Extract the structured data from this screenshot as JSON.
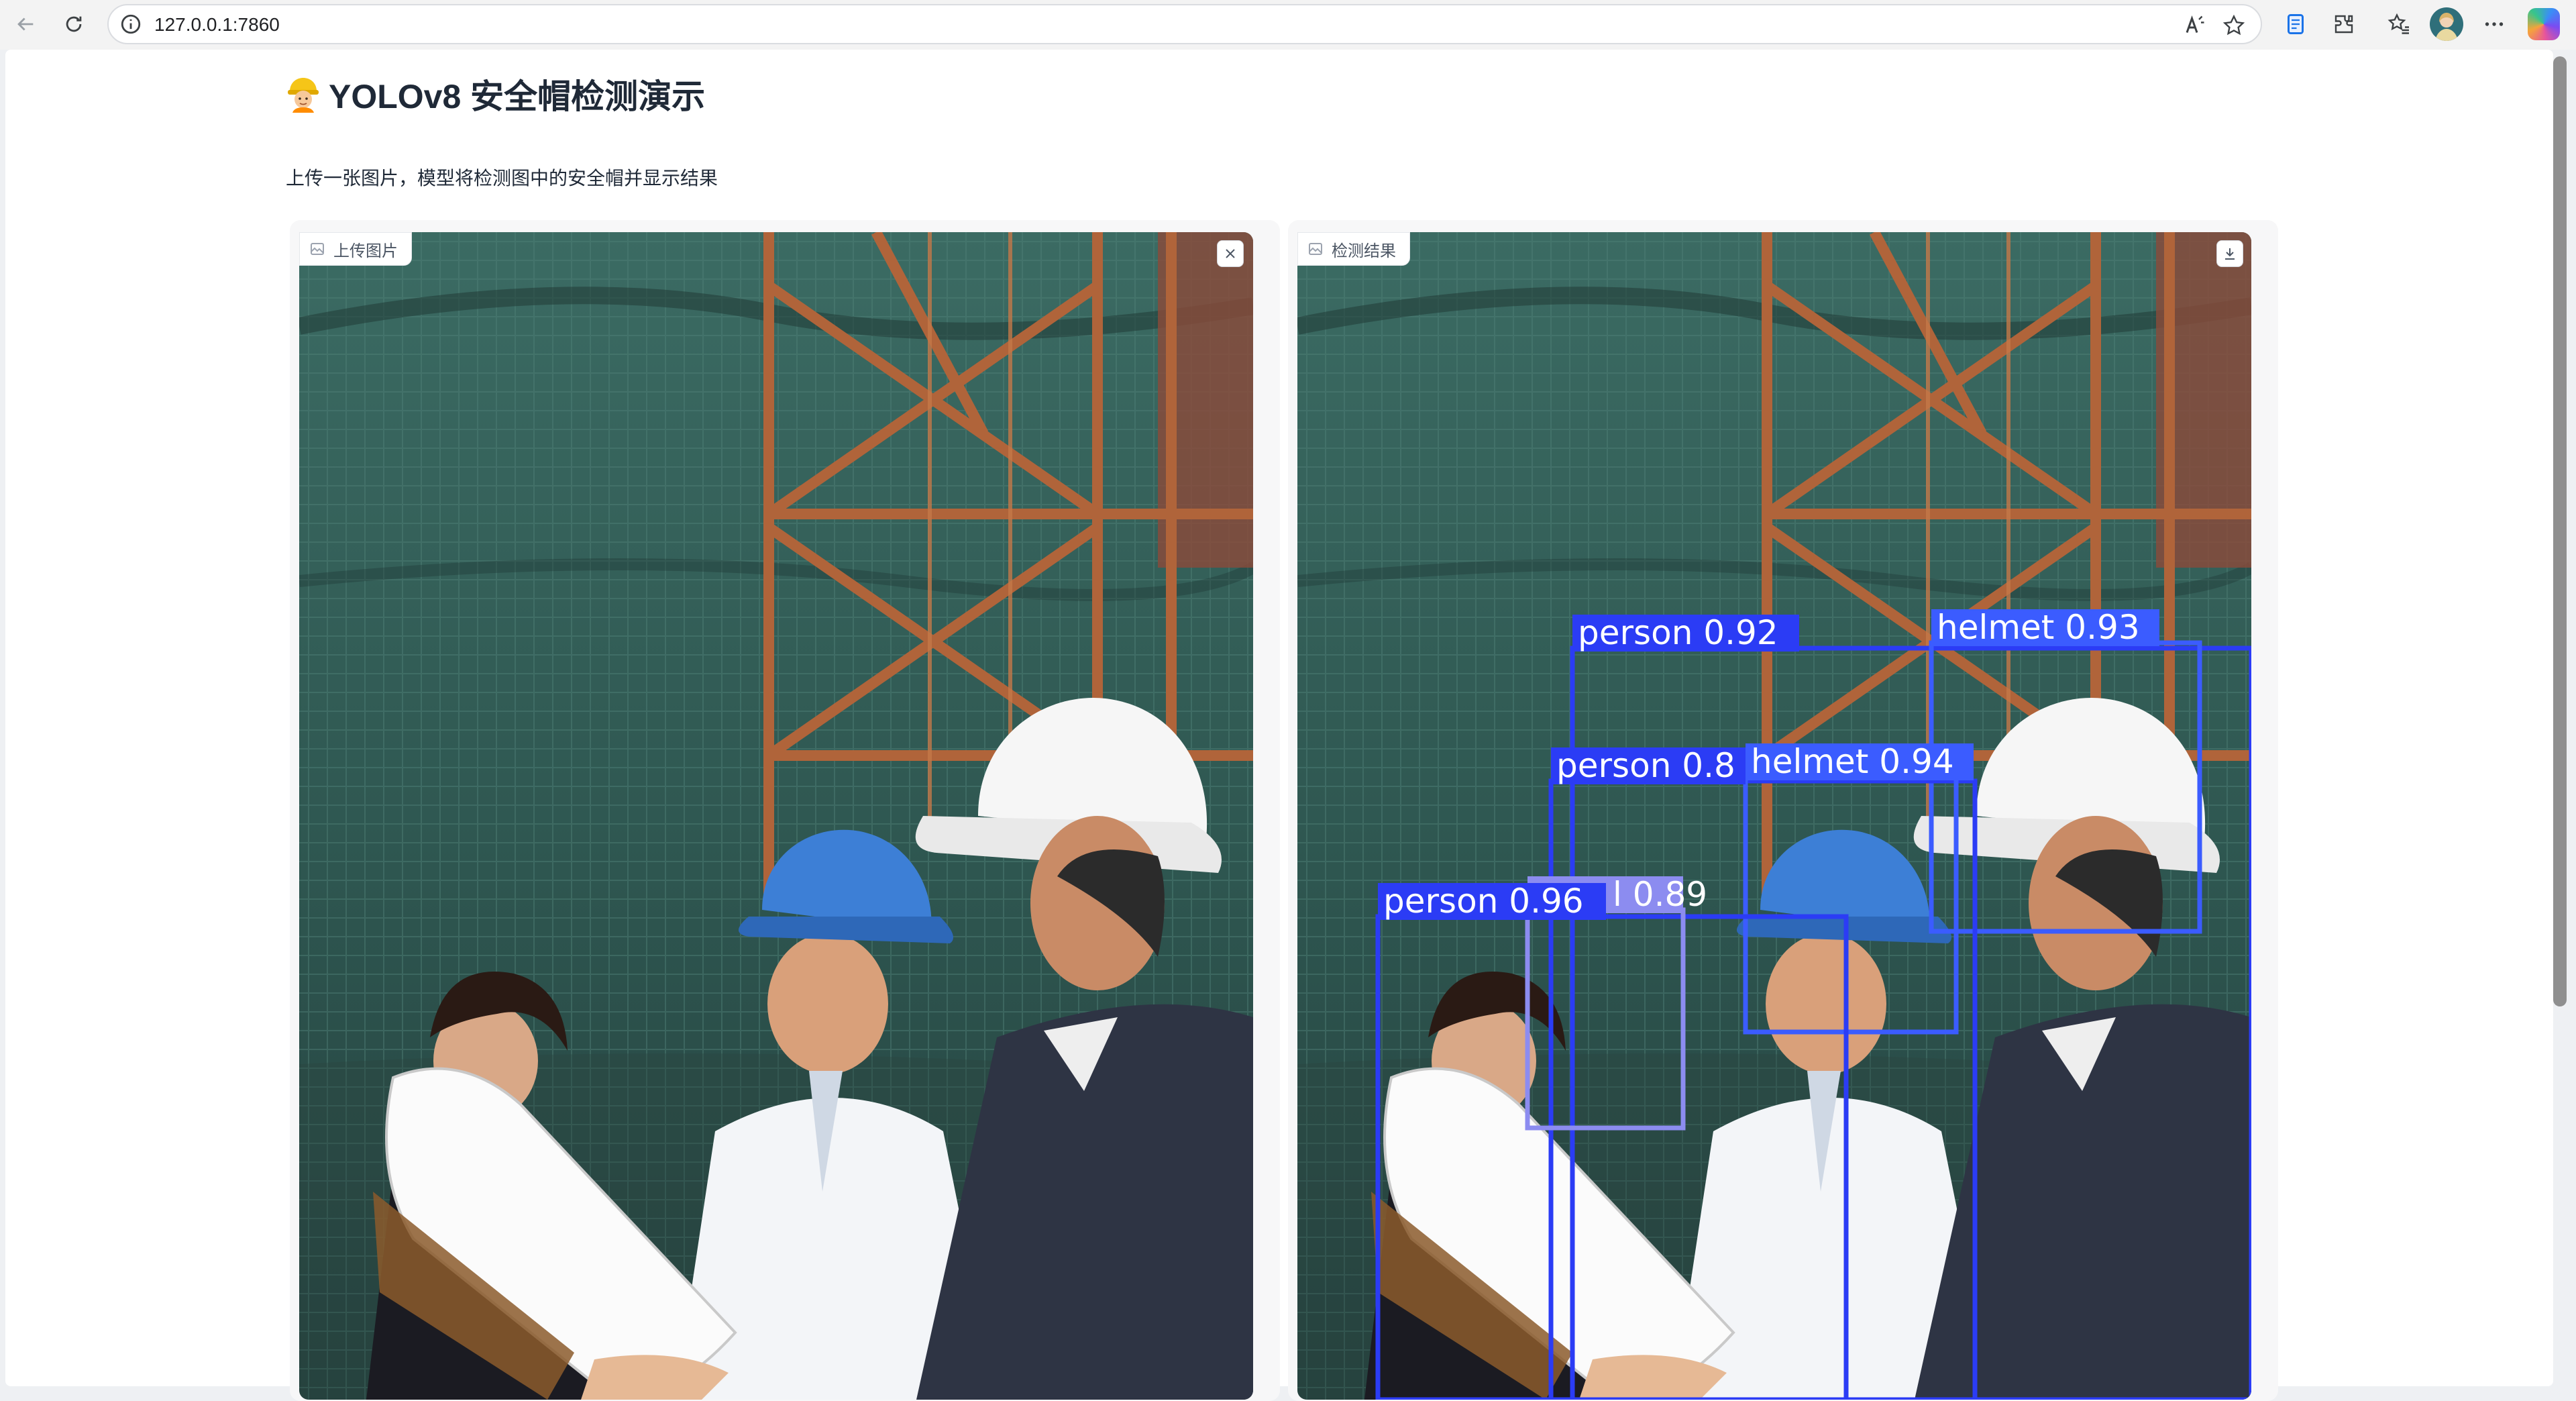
{
  "browser": {
    "url": "127.0.0.1:7860",
    "icons": [
      "back-icon",
      "reload-icon",
      "info-icon",
      "read-aloud-icon",
      "favorite-star-icon",
      "reading-view-icon",
      "extensions-icon",
      "favorites-icon",
      "profile-avatar",
      "more-icon",
      "copilot-icon"
    ]
  },
  "page": {
    "title": "YOLOv8 安全帽检测演示",
    "title_icon": "construction-worker-emoji",
    "subtitle": "上传一张图片，模型将检测图中的安全帽并显示结果"
  },
  "input_panel": {
    "label": "上传图片",
    "label_icon": "image-icon",
    "action_icon": "close-icon"
  },
  "output_panel": {
    "label": "检测结果",
    "label_icon": "image-icon",
    "action_icon": "download-icon",
    "detections": [
      {
        "class": "person",
        "score": "0.92",
        "label": "person 0.92"
      },
      {
        "class": "helmet",
        "score": "0.93",
        "label": "helmet 0.93"
      },
      {
        "class": "person",
        "label": "person 0.8"
      },
      {
        "class": "helmet",
        "score": "0.94",
        "label": "helmet 0.94"
      },
      {
        "class": "person",
        "score": "0.96",
        "label": "person 0.96"
      },
      {
        "label": "l 0.89"
      }
    ]
  },
  "colors": {
    "box_blue": "#2b3cf5",
    "box_blue_light": "#3b5cff",
    "box_lavender": "#8c8cf0",
    "net_green": "#2f5a52",
    "scaffold_orange": "#b0643a"
  }
}
